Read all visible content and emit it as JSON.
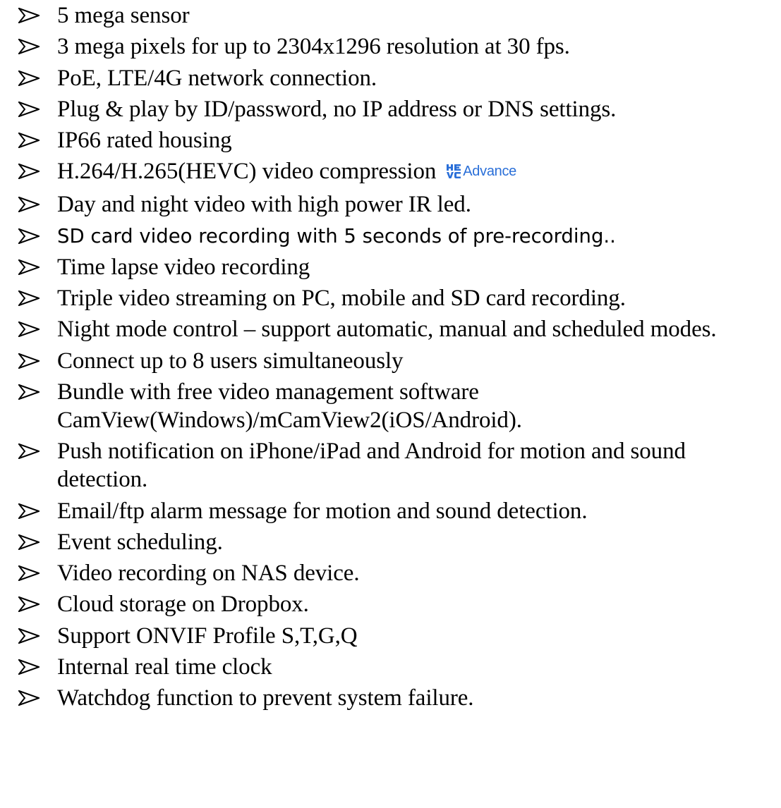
{
  "features": [
    {
      "text": "5 mega sensor"
    },
    {
      "text": "3 mega pixels for up to 2304x1296 resolution at 30 fps."
    },
    {
      "text": "PoE, LTE/4G network connection."
    },
    {
      "text": "Plug & play by ID/password, no IP address or DNS settings."
    },
    {
      "text": "IP66 rated housing"
    },
    {
      "text": "H.264/H.265(HEVC) video compression"
    },
    {
      "text": "Day and night video with high power IR led."
    },
    {
      "text": "SD card video recording with 5 seconds of pre-recording.."
    },
    {
      "text": "Time lapse video recording"
    },
    {
      "text": "Triple video streaming on PC, mobile and SD card recording."
    },
    {
      "text": "Night mode control – support automatic, manual and scheduled modes."
    },
    {
      "text": "Connect up to 8 users simultaneously"
    },
    {
      "text": "Bundle with free video management software CamView(Windows)/mCamView2(iOS/Android)."
    },
    {
      "text": "Push notification on iPhone/iPad and Android for motion and sound detection."
    },
    {
      "text": "Email/ftp alarm message for motion and sound detection."
    },
    {
      "text": "Event scheduling."
    },
    {
      "text": "Video recording on NAS device."
    },
    {
      "text": "Cloud storage on Dropbox."
    },
    {
      "text": "Support ONVIF Profile S,T,G,Q"
    },
    {
      "text": "Internal real time clock"
    },
    {
      "text": "Watchdog function to prevent system failure."
    }
  ],
  "hevc_logo": {
    "word": "Advance",
    "color": "#2a6fd8"
  },
  "bullet_icon": "arrowhead-bullet-icon"
}
